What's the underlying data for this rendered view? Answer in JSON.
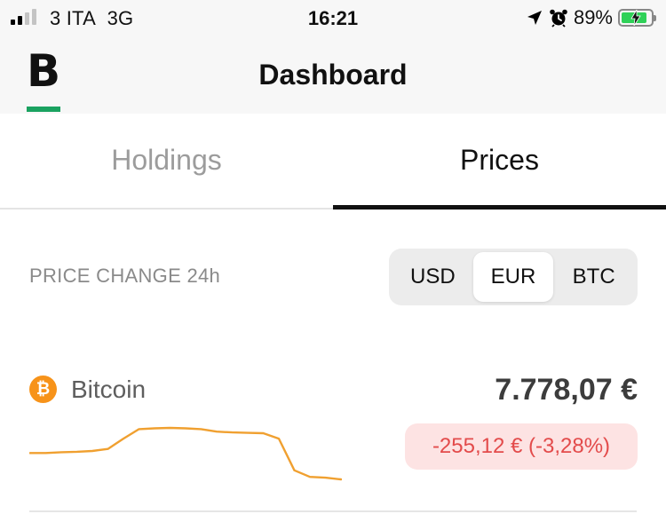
{
  "status_bar": {
    "carrier": "3 ITA",
    "network": "3G",
    "time": "16:21",
    "battery_percent": "89%",
    "battery_level": 0.89,
    "signal_bars_on": 2,
    "signal_bars_total": 4
  },
  "header": {
    "logo_letter": "B",
    "title": "Dashboard"
  },
  "tabs": [
    {
      "label": "Holdings",
      "active": false
    },
    {
      "label": "Prices",
      "active": true
    }
  ],
  "price_change": {
    "label": "PRICE CHANGE 24h",
    "currencies": [
      "USD",
      "EUR",
      "BTC"
    ],
    "selected": "EUR"
  },
  "coins": [
    {
      "name": "Bitcoin",
      "icon": "bitcoin-icon",
      "icon_symbol": "₿",
      "price": "7.778,07  €",
      "change": "-255,12  € (-3,28%)",
      "sparkline": [
        0.0,
        0.0,
        0.02,
        0.03,
        0.05,
        0.1,
        0.35,
        0.58,
        0.6,
        0.61,
        0.6,
        0.58,
        0.52,
        0.5,
        0.49,
        0.48,
        0.35,
        -0.42,
        -0.58,
        -0.6,
        -0.64
      ]
    }
  ],
  "colors": {
    "accent": "#1aa260",
    "bitcoin": "#f7931a",
    "negative_text": "#e34b4b",
    "negative_bg": "#fde3e3",
    "sparkline": "#f0a030"
  }
}
